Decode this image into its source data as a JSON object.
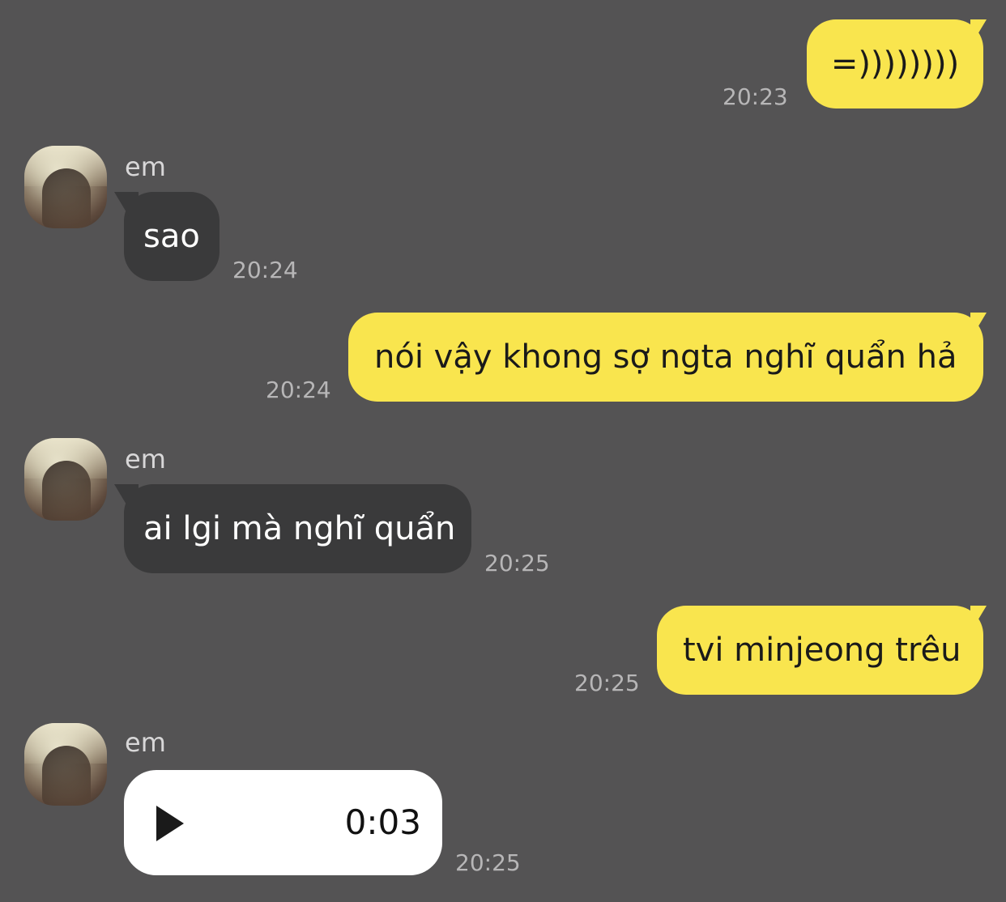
{
  "contact": {
    "name": "em"
  },
  "messages": [
    {
      "direction": "outgoing",
      "text": "=))))))))",
      "time": "20:23"
    },
    {
      "direction": "incoming",
      "sender": "em",
      "text": "sao",
      "time": "20:24"
    },
    {
      "direction": "outgoing",
      "text": "nói vậy khong sợ ngta nghĩ quẩn hả",
      "time": "20:24"
    },
    {
      "direction": "incoming",
      "sender": "em",
      "text": "ai lgi mà nghĩ quẩn",
      "time": "20:25"
    },
    {
      "direction": "outgoing",
      "text": "tvi minjeong trêu",
      "time": "20:25"
    },
    {
      "direction": "incoming",
      "sender": "em",
      "type": "voice",
      "duration": "0:03",
      "time": "20:25",
      "icon": "play-icon"
    }
  ],
  "colors": {
    "background": "#545354",
    "outgoing_bubble": "#f9e54e",
    "incoming_bubble": "#3a3a3b",
    "voice_bubble": "#ffffff",
    "timestamp": "#b7b6b7"
  }
}
